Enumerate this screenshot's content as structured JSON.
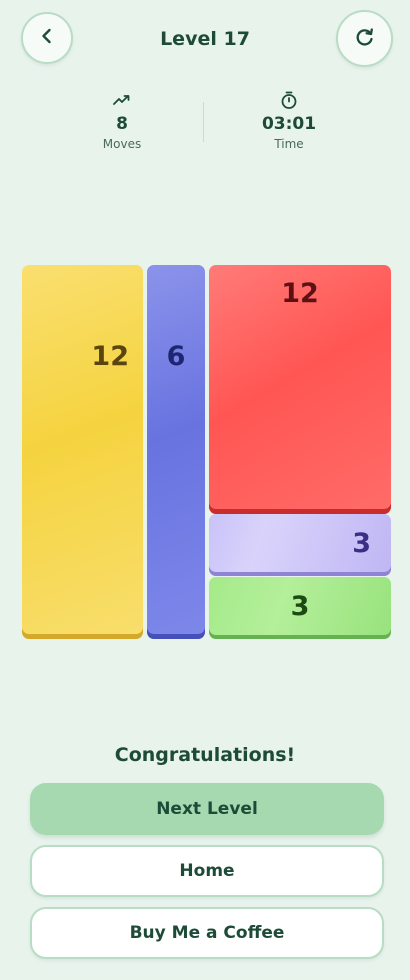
{
  "header": {
    "title": "Level 17",
    "back_icon": "chevron-left-icon",
    "restart_icon": "refresh-icon"
  },
  "stats": {
    "moves": {
      "icon": "trending-up-icon",
      "value": "8",
      "label": "Moves"
    },
    "time": {
      "icon": "stopwatch-icon",
      "value": "03:01",
      "label": "Time"
    }
  },
  "board": {
    "blocks": [
      {
        "color": "yellow",
        "value": "12"
      },
      {
        "color": "blue",
        "value": "6"
      },
      {
        "color": "red",
        "value": "12"
      },
      {
        "color": "purple",
        "value": "3"
      },
      {
        "color": "green",
        "value": "3"
      }
    ]
  },
  "result": {
    "message": "Congratulations!",
    "next_label": "Next Level",
    "home_label": "Home",
    "coffee_label": "Buy Me a Coffee"
  },
  "colors": {
    "background": "#e8f3ec",
    "accent": "#a7d9b0",
    "text": "#1d4b38"
  }
}
